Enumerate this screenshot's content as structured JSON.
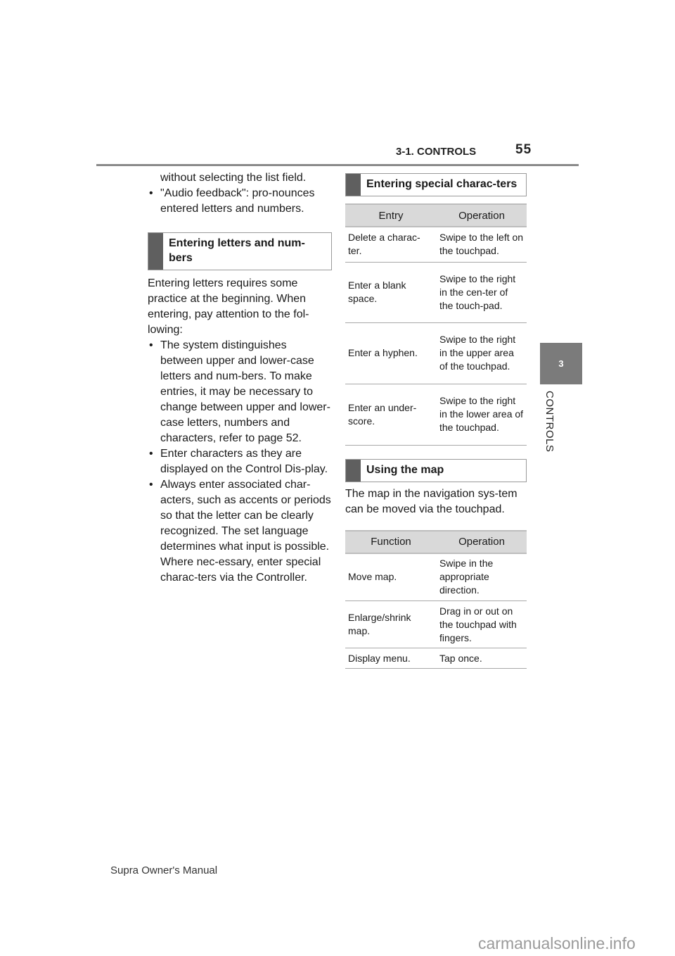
{
  "header": {
    "section": "3-1. CONTROLS",
    "page_number": "55"
  },
  "side_tab": {
    "number": "3",
    "label": "CONTROLS"
  },
  "left_column": {
    "continuation": "without selecting the list field.",
    "bullet_audio": "\"Audio feedback\": pro-nounces entered letters and numbers.",
    "section_title": "Entering letters and num-bers",
    "intro": "Entering letters requires some practice at the beginning. When entering, pay attention to the fol-lowing:",
    "bullets": [
      "The system distinguishes between upper and lower-case letters and num-bers. To make entries, it may be necessary to change between upper and lower-case letters, numbers and characters, refer to page 52.",
      "Enter characters as they are displayed on the Control Dis-play.",
      "Always enter associated char-acters, such as accents or periods so that the letter can be clearly recognized. The set language determines what input is possible. Where nec-essary, enter special charac-ters via the Controller."
    ]
  },
  "right_column": {
    "special_chars": {
      "title": "Entering special charac-ters",
      "headers": [
        "Entry",
        "Operation"
      ],
      "rows": [
        [
          "Delete a charac-ter.",
          "Swipe to the left on the touchpad."
        ],
        [
          "Enter a blank space.",
          "Swipe to the right in the cen-ter of the touch-pad."
        ],
        [
          "Enter a hyphen.",
          "Swipe to the right in the upper area of the touchpad."
        ],
        [
          "Enter an under-score.",
          "Swipe to the right in the lower area of the touchpad."
        ]
      ]
    },
    "map": {
      "title": "Using the map",
      "intro": "The map in the navigation sys-tem can be moved via the touchpad.",
      "headers": [
        "Function",
        "Operation"
      ],
      "rows": [
        [
          "Move map.",
          "Swipe in the appropriate direction."
        ],
        [
          "Enlarge/shrink map.",
          "Drag in or out on the touchpad with fingers."
        ],
        [
          "Display menu.",
          "Tap once."
        ]
      ]
    }
  },
  "footer": {
    "manual_name": "Supra Owner's Manual",
    "watermark": "carmanualsonline.info"
  }
}
